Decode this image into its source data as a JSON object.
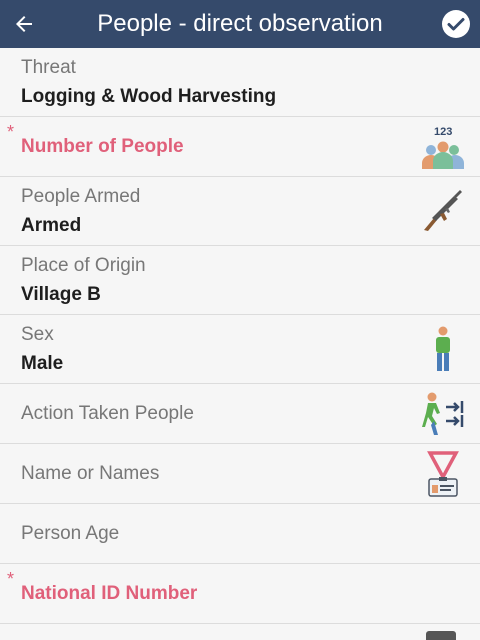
{
  "header": {
    "title": "People - direct observation",
    "back_icon": "arrow-left-icon",
    "confirm_icon": "check-circle-icon"
  },
  "fields": [
    {
      "label": "Threat",
      "value": "Logging & Wood Harvesting",
      "required": false,
      "icon": null
    },
    {
      "label": "Number of People",
      "value": "",
      "required": true,
      "icon": "people-count-icon",
      "icon_text": "123"
    },
    {
      "label": "People Armed",
      "value": "Armed",
      "required": false,
      "icon": "rifle-icon"
    },
    {
      "label": "Place of Origin",
      "value": "Village B",
      "required": false,
      "icon": null
    },
    {
      "label": "Sex",
      "value": "Male",
      "required": false,
      "icon": "person-icon"
    },
    {
      "label": "Action Taken People",
      "value": "",
      "required": false,
      "icon": "walking-person-arrows-icon"
    },
    {
      "label": "Name or Names",
      "value": "",
      "required": false,
      "icon": "id-badge-icon"
    },
    {
      "label": "Person Age",
      "value": "",
      "required": false,
      "icon": null
    },
    {
      "label": "National ID Number",
      "value": "",
      "required": true,
      "icon": null
    }
  ],
  "required_marker": "*",
  "colors": {
    "appbar": "#354a6b",
    "required": "#e0607a",
    "label": "#777777",
    "value": "#1e1e1e"
  }
}
